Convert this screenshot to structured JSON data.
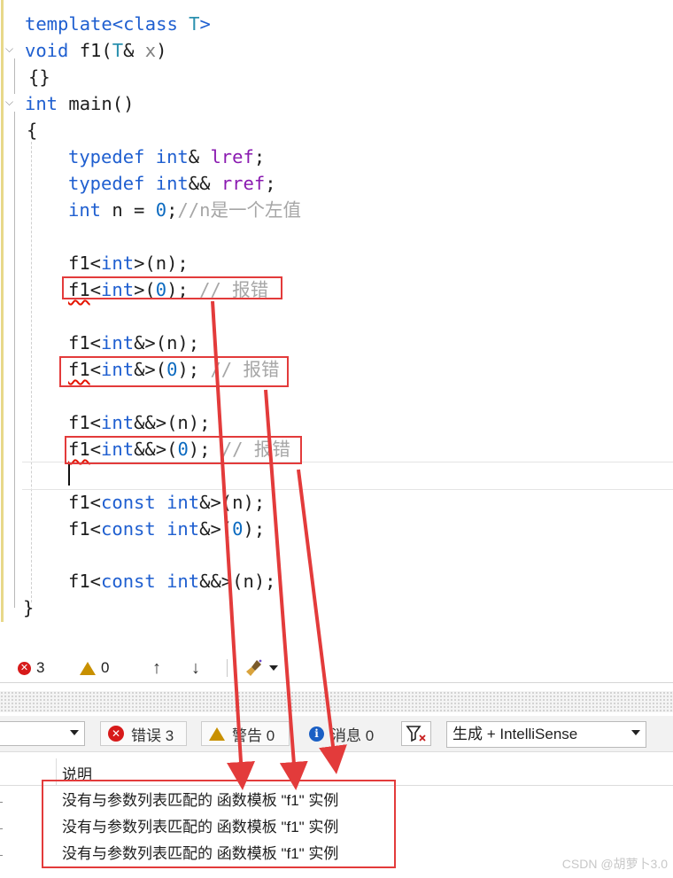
{
  "editor": {
    "lines": {
      "l1": {
        "kw1": "template",
        "sym1": "<",
        "kw2": "class",
        "sp": " ",
        "tp": "T",
        "sym2": ">"
      },
      "l2": {
        "kw": "void",
        "name": " f1(",
        "tp": "T",
        "amp": "& ",
        "param": "x",
        "close": ")"
      },
      "l3": {
        "text": "{}"
      },
      "l4": {
        "kw": "int",
        "rest": " main()"
      },
      "l5": {
        "text": "{"
      },
      "l6": {
        "kw1": "typedef",
        "sp": " ",
        "kw2": "int",
        "amp": "& ",
        "alias": "lref",
        "semi": ";"
      },
      "l7": {
        "kw1": "typedef",
        "sp": " ",
        "kw2": "int",
        "amp": "&& ",
        "alias": "rref",
        "semi": ";"
      },
      "l8": {
        "kw": "int",
        "mid": " n = ",
        "num": "0",
        "semi": ";",
        "cmt": "//n是一个左值"
      },
      "l9": {
        "a": "f1<",
        "kw": "int",
        "b": ">(n);"
      },
      "l10": {
        "fn": "f1",
        "a": "<",
        "kw": "int",
        "b": ">(",
        "num": "0",
        "c": "); ",
        "cmt": "// 报错"
      },
      "l11": {
        "a": "f1<",
        "kw": "int",
        "b": "&>(n);"
      },
      "l12": {
        "fn": "f1",
        "a": "<",
        "kw": "int",
        "b": "&>(",
        "num": "0",
        "c": "); ",
        "cmt": "// 报错"
      },
      "l13": {
        "a": "f1<",
        "kw": "int",
        "b": "&&>(n);"
      },
      "l14": {
        "fn": "f1",
        "a": "<",
        "kw": "int",
        "b": "&&>(",
        "num": "0",
        "c": "); ",
        "cmt": "// 报错"
      },
      "l15": {
        "a": "f1<",
        "kw1": "const",
        "sp": " ",
        "kw2": "int",
        "b": "&>(n);"
      },
      "l16": {
        "a": "f1<",
        "kw1": "const",
        "sp": " ",
        "kw2": "int",
        "b": "&>(",
        "num": "0",
        "c": ");"
      },
      "l17": {
        "a": "f1<",
        "kw1": "const",
        "sp": " ",
        "kw2": "int",
        "b": "&&>(n);"
      },
      "l18": {
        "text": "}"
      }
    }
  },
  "status": {
    "errors": "3",
    "warnings": "0",
    "up_arrow": "↑",
    "down_arrow": "↓"
  },
  "error_list": {
    "errors_button": "错误 3",
    "warnings_button": "警告 0",
    "messages_button": "消息 0",
    "build_filter": "生成 + IntelliSense",
    "column_description": "说明",
    "rows": [
      "没有与参数列表匹配的 函数模板 \"f1\" 实例",
      "没有与参数列表匹配的 函数模板 \"f1\" 实例",
      "没有与参数列表匹配的 函数模板 \"f1\" 实例"
    ]
  },
  "annotation_color": "#e33b3b",
  "watermark": "CSDN @胡萝卜3.0"
}
